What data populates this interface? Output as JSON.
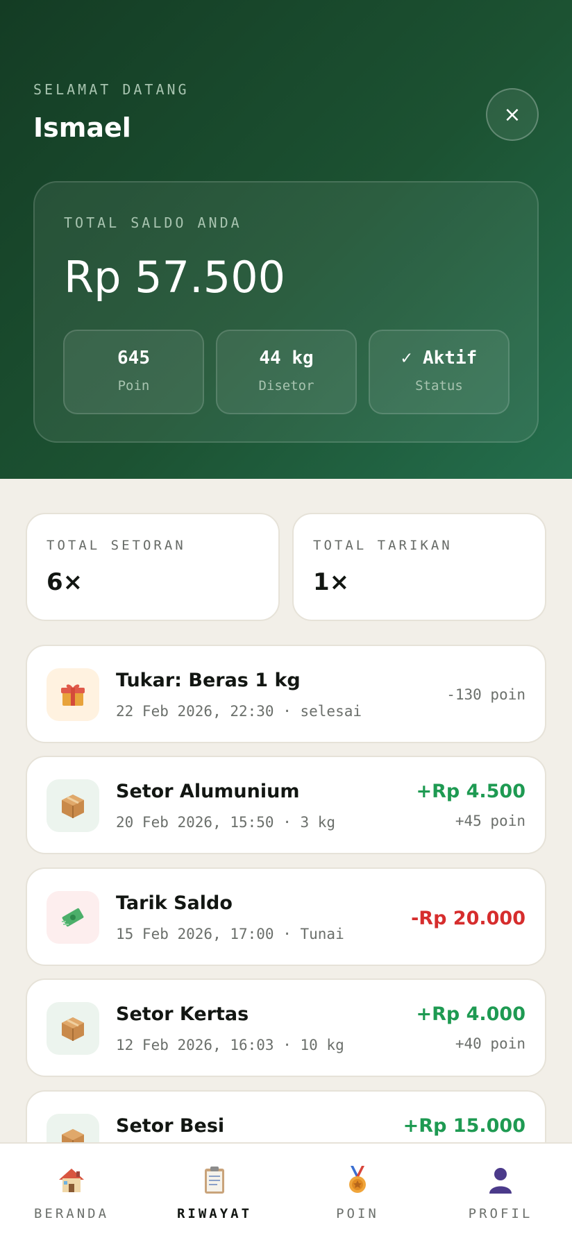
{
  "header": {
    "welcome_label": "SELAMAT DATANG",
    "user_name": "Ismael",
    "close_label": "×"
  },
  "balance": {
    "label": "TOTAL SALDO ANDA",
    "amount": "Rp 57.500",
    "stats": [
      {
        "value": "645",
        "label": "Poin"
      },
      {
        "value": "44 kg",
        "label": "Disetor"
      },
      {
        "value": "✓ Aktif",
        "label": "Status"
      }
    ]
  },
  "summary": {
    "deposits": {
      "label": "TOTAL SETORAN",
      "value": "6×"
    },
    "withdrawals": {
      "label": "TOTAL TARIKAN",
      "value": "1×"
    }
  },
  "transactions": [
    {
      "icon": "gift-icon",
      "title": "Tukar: Beras 1 kg",
      "subtitle": "22 Feb 2026, 22:30 · selesai",
      "amount": "",
      "points": "-130 poin",
      "amount_color": "#6b6f6b"
    },
    {
      "icon": "package-icon",
      "title": "Setor Alumunium",
      "subtitle": "20 Feb 2026, 15:50 · 3 kg",
      "amount": "+Rp 4.500",
      "points": "+45 poin",
      "amount_color": "#1e9a52"
    },
    {
      "icon": "money-icon",
      "title": "Tarik Saldo",
      "subtitle": "15 Feb 2026, 17:00 · Tunai",
      "amount": "-Rp 20.000",
      "points": "",
      "amount_color": "#d62d2d"
    },
    {
      "icon": "package-icon",
      "title": "Setor Kertas",
      "subtitle": "12 Feb 2026, 16:03 · 10 kg",
      "amount": "+Rp 4.000",
      "points": "+40 poin",
      "amount_color": "#1e9a52"
    },
    {
      "icon": "package-icon",
      "title": "Setor Besi",
      "subtitle": "",
      "amount": "+Rp 15.000",
      "points": "",
      "amount_color": "#1e9a52"
    }
  ],
  "nav": {
    "items": [
      {
        "label": "BERANDA",
        "icon": "house-icon",
        "active": false
      },
      {
        "label": "RIWAYAT",
        "icon": "clipboard-icon",
        "active": true
      },
      {
        "label": "POIN",
        "icon": "medal-icon",
        "active": false
      },
      {
        "label": "PROFIL",
        "icon": "user-icon",
        "active": false
      }
    ]
  },
  "colors": {
    "brand_dark": "#143c24",
    "positive": "#1e9a52",
    "negative": "#d62d2d",
    "background": "#f2efe8"
  }
}
